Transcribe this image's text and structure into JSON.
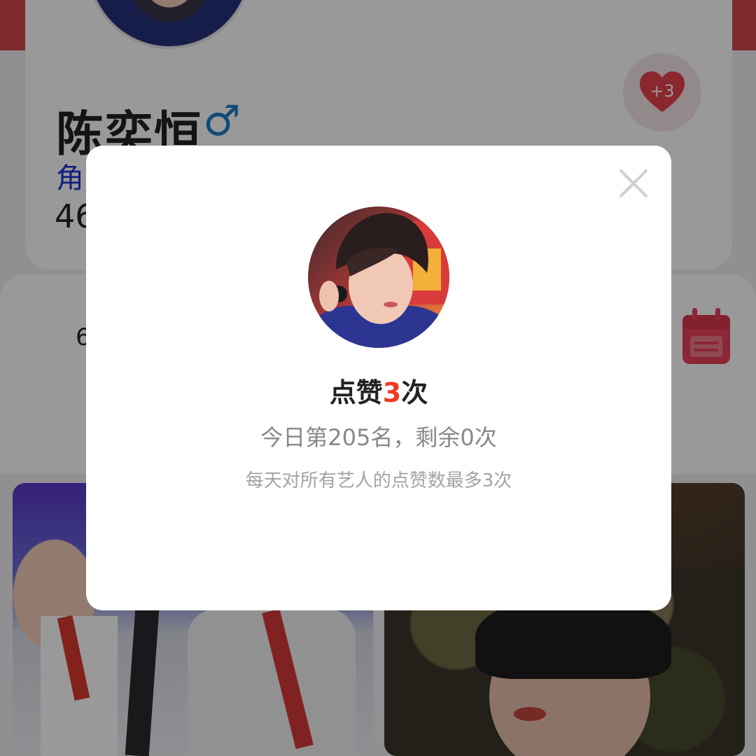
{
  "profile": {
    "name": "陈奕恒",
    "gender_symbol": "♂",
    "role_label_partial": "角",
    "count_partial": "46"
  },
  "like_button": {
    "badge": "+3",
    "icon": "heart-icon"
  },
  "stats": {
    "text1_partial": "",
    "text2_partial": "6",
    "calendar_icon": "calendar-icon"
  },
  "modal": {
    "title_prefix": "点赞",
    "title_count": "3",
    "title_suffix": "次",
    "rank_text": "今日第205名，剩余0次",
    "note": "每天对所有艺人的点赞数最多3次",
    "close_icon": "close-icon"
  },
  "colors": {
    "accent": "#ee3a22",
    "heart": "#e8414f",
    "gender": "#1a7ecb",
    "role": "#1a33d6",
    "calendar": "#e8415a"
  }
}
